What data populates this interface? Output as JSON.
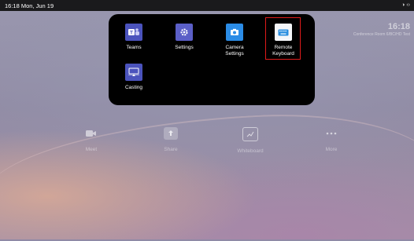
{
  "statusbar": {
    "time": "16:18 Mon, Jun 19",
    "sys_icons": "◑ ‹›"
  },
  "clock": {
    "time": "16:18",
    "subtitle": "Conference Room 6/BC/HD Test"
  },
  "popup": {
    "apps": [
      {
        "label": "Teams",
        "icon": "teams-icon",
        "color": "#4b53bc"
      },
      {
        "label": "Settings",
        "icon": "settings-gear-icon",
        "color": "#5b5fc7"
      },
      {
        "label": "Camera\nSettings",
        "icon": "camera-icon",
        "color": "#2b8ce6"
      },
      {
        "label": "Remote\nKeyboard",
        "icon": "keyboard-icon",
        "color": "#2a8fe0"
      },
      {
        "label": "Casting",
        "icon": "casting-icon",
        "color": "#4b53bc"
      }
    ]
  },
  "dock": {
    "items": [
      {
        "label": "Meet",
        "icon": "video-camera-icon"
      },
      {
        "label": "Share",
        "icon": "share-icon"
      },
      {
        "label": "Whiteboard",
        "icon": "whiteboard-icon"
      },
      {
        "label": "More",
        "icon": "more-dots-icon"
      }
    ]
  },
  "colors": {
    "highlight": "#e01b1b",
    "popup_bg": "#000000"
  }
}
